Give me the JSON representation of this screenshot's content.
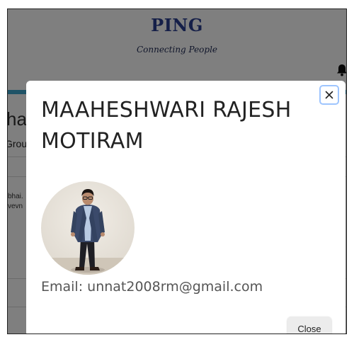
{
  "header": {
    "brand": "PING",
    "tagline": "Connecting People",
    "bell_icon": "bell-icon"
  },
  "background": {
    "heading_fragment": "ha",
    "tab_fragment": "Grou",
    "message_fragment_1": "bhai.",
    "message_fragment_2": "vevn"
  },
  "modal": {
    "title": "MAAHESHWARI RAJESH MOTIRAM",
    "close_icon": "close-icon",
    "email_text": "Email: unnat2008rm@gmail.com",
    "close_button_label": "Close"
  },
  "colors": {
    "brand": "#2b3f91",
    "accent_bar": "#3ea6cf",
    "close_focus_ring": "#9ec5fe"
  }
}
